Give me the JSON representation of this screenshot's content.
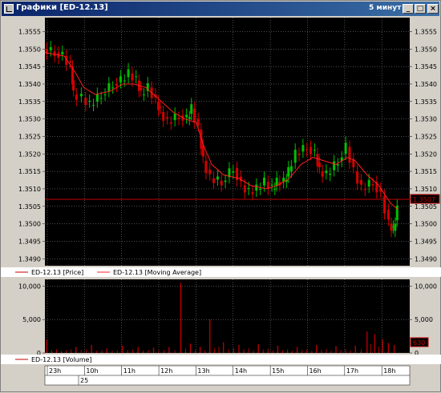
{
  "window": {
    "title": "Графики [ED-12.13]",
    "period": "5 минут",
    "minimize_glyph": "_",
    "maximize_glyph": "□",
    "close_glyph": "×"
  },
  "colors": {
    "background": "#000000",
    "up_candle": "#00c000",
    "down_candle": "#d40000",
    "moving_average": "#ff2020",
    "price_line": "#c00000",
    "volume": "#b40000",
    "grid": "#9a9a9a"
  },
  "chart_data": [
    {
      "type": "candlestick",
      "legend": [
        "ED-12.13 [Price]",
        "ED-12.13 [Moving Average]"
      ],
      "y_ticks_left": [
        "1.3555",
        "1.3550",
        "1.3545",
        "1.3540",
        "1.3535",
        "1.3530",
        "1.3525",
        "1.3520",
        "1.3515",
        "1.3510",
        "1.3505",
        "1.3500",
        "1.3495",
        "1.3490"
      ],
      "y_ticks_right": [
        "1.3555",
        "1.3550",
        "1.3545",
        "1.3540",
        "1.3535",
        "1.3530",
        "1.3525",
        "1.3520",
        "1.3515",
        "1.3510",
        "1.3505",
        "1.3500",
        "1.3495",
        "1.3490"
      ],
      "ylim": [
        1.3488,
        1.3559
      ],
      "current_price": 1.3507,
      "current_price_tag": "1.3507",
      "grid": true,
      "series": {
        "price_close": [
          [
            0,
            1.355
          ],
          [
            0.3,
            1.3549
          ],
          [
            0.5,
            1.3548
          ],
          [
            0.7,
            1.3545
          ],
          [
            0.75,
            1.3537
          ],
          [
            1.0,
            1.3536
          ],
          [
            1.2,
            1.3534
          ],
          [
            1.5,
            1.3537
          ],
          [
            1.8,
            1.354
          ],
          [
            2.0,
            1.3541
          ],
          [
            2.2,
            1.3543
          ],
          [
            2.4,
            1.3541
          ],
          [
            2.5,
            1.3537
          ],
          [
            2.7,
            1.3539
          ],
          [
            2.9,
            1.3535
          ],
          [
            3.0,
            1.3532
          ],
          [
            3.2,
            1.3529
          ],
          [
            3.5,
            1.3531
          ],
          [
            3.7,
            1.353
          ],
          [
            3.8,
            1.3533
          ],
          [
            4.0,
            1.3527
          ],
          [
            4.1,
            1.3518
          ],
          [
            4.3,
            1.3513
          ],
          [
            4.6,
            1.3512
          ],
          [
            4.9,
            1.3516
          ],
          [
            5.1,
            1.3511
          ],
          [
            5.3,
            1.3509
          ],
          [
            5.5,
            1.351
          ],
          [
            5.7,
            1.3512
          ],
          [
            5.9,
            1.351
          ],
          [
            6.0,
            1.3512
          ],
          [
            6.2,
            1.3512
          ],
          [
            6.3,
            1.3515
          ],
          [
            6.5,
            1.352
          ],
          [
            6.8,
            1.3522
          ],
          [
            7.0,
            1.352
          ],
          [
            7.1,
            1.3515
          ],
          [
            7.3,
            1.3514
          ],
          [
            7.6,
            1.3518
          ],
          [
            7.8,
            1.3522
          ],
          [
            8.0,
            1.3515
          ],
          [
            8.2,
            1.351
          ],
          [
            8.5,
            1.3512
          ],
          [
            8.7,
            1.3508
          ],
          [
            8.9,
            1.35
          ],
          [
            9.0,
            1.3498
          ],
          [
            9.1,
            1.3504
          ]
        ],
        "moving_average": [
          [
            0,
            1.3549
          ],
          [
            0.5,
            1.3548
          ],
          [
            0.8,
            1.3543
          ],
          [
            1.0,
            1.3539
          ],
          [
            1.3,
            1.3537
          ],
          [
            1.7,
            1.3538
          ],
          [
            2.0,
            1.354
          ],
          [
            2.3,
            1.354
          ],
          [
            2.6,
            1.3539
          ],
          [
            3.0,
            1.3535
          ],
          [
            3.3,
            1.3532
          ],
          [
            3.6,
            1.353
          ],
          [
            3.9,
            1.3529
          ],
          [
            4.1,
            1.3522
          ],
          [
            4.3,
            1.3517
          ],
          [
            4.6,
            1.3514
          ],
          [
            5.0,
            1.3513
          ],
          [
            5.3,
            1.3511
          ],
          [
            5.7,
            1.351
          ],
          [
            6.0,
            1.3511
          ],
          [
            6.3,
            1.3513
          ],
          [
            6.6,
            1.3517
          ],
          [
            6.9,
            1.3519
          ],
          [
            7.2,
            1.3518
          ],
          [
            7.5,
            1.3517
          ],
          [
            7.8,
            1.3519
          ],
          [
            8.0,
            1.3518
          ],
          [
            8.3,
            1.3514
          ],
          [
            8.6,
            1.3511
          ],
          [
            8.9,
            1.3506
          ],
          [
            9.1,
            1.3504
          ]
        ]
      }
    },
    {
      "type": "bar",
      "legend": [
        "ED-12.13 [Volume]"
      ],
      "y_ticks_left": [
        "10,000",
        "5,000",
        "0"
      ],
      "y_ticks_right": [
        "10,000",
        "5,000",
        "0"
      ],
      "ylim": [
        0,
        11000
      ],
      "current_value_tag": "630",
      "values": [
        [
          0.05,
          2000
        ],
        [
          0.8,
          900
        ],
        [
          1.2,
          1200
        ],
        [
          1.6,
          700
        ],
        [
          2.0,
          1100
        ],
        [
          2.4,
          900
        ],
        [
          2.8,
          800
        ],
        [
          3.2,
          900
        ],
        [
          3.5,
          10500
        ],
        [
          3.75,
          1400
        ],
        [
          4.0,
          900
        ],
        [
          4.25,
          5000
        ],
        [
          4.6,
          1600
        ],
        [
          5.0,
          1200
        ],
        [
          5.5,
          1300
        ],
        [
          6.0,
          1100
        ],
        [
          6.5,
          900
        ],
        [
          7.0,
          1200
        ],
        [
          7.5,
          1000
        ],
        [
          8.0,
          1100
        ],
        [
          8.3,
          3200
        ],
        [
          8.5,
          2800
        ],
        [
          8.7,
          2000
        ],
        [
          8.85,
          1500
        ],
        [
          9.0,
          1200
        ]
      ]
    }
  ],
  "time_axis": {
    "labels": [
      "23h",
      "10h",
      "11h",
      "12h",
      "13h",
      "14h",
      "15h",
      "16h",
      "17h",
      "18h"
    ],
    "date_label": "25"
  }
}
